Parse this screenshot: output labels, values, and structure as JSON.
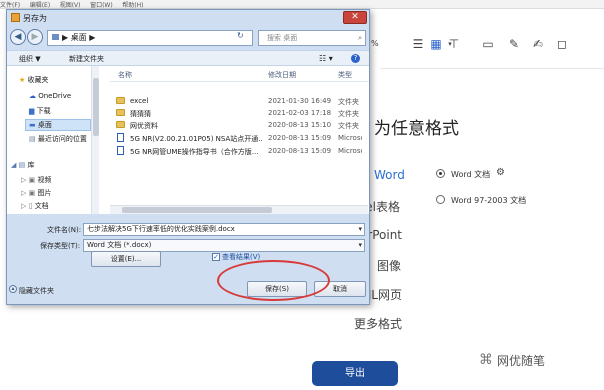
{
  "bg_app": {
    "menu": [
      "文件(F)",
      "编辑(E)",
      "视图(V)",
      "窗口(W)",
      "帮助(H)"
    ],
    "zoom": "%",
    "heading": "为任意格式",
    "formats": [
      "Word",
      "Excel表格",
      "PowerPoint",
      "图像",
      "HTML网页",
      "更多格式"
    ],
    "radio_options": [
      {
        "label": "Word 文档",
        "selected": true
      },
      {
        "label": "Word 97-2003 文档",
        "selected": false
      }
    ],
    "export_button": "导出",
    "watermark": "网优随笔"
  },
  "dialog": {
    "title": "另存为",
    "close": "✕",
    "breadcrumb": "▶ 桌面 ▶",
    "search_placeholder": "搜索 桌面",
    "toolbar": {
      "organize": "组织 ▼",
      "new_folder": "新建文件夹"
    },
    "nav_items": [
      {
        "label": "收藏夹",
        "icon": "star-icon"
      },
      {
        "label": "OneDrive",
        "icon": "cloud-icon"
      },
      {
        "label": "下载",
        "icon": "download-folder-icon"
      },
      {
        "label": "桌面",
        "icon": "desktop-icon",
        "selected": true
      },
      {
        "label": "最近访问的位置",
        "icon": "recent-icon"
      },
      {
        "label": "库",
        "icon": "library-icon"
      },
      {
        "label": "视频",
        "icon": "video-icon"
      },
      {
        "label": "图片",
        "icon": "picture-icon"
      },
      {
        "label": "文档",
        "icon": "document-icon"
      },
      {
        "label": "音乐",
        "icon": "music-icon"
      }
    ],
    "columns": [
      "名称",
      "修改日期",
      "类型"
    ],
    "files": [
      {
        "name": "excel",
        "date": "2021-01-30 16:49",
        "type": "文件夹",
        "kind": "folder"
      },
      {
        "name": "猜猜猜",
        "date": "2021-02-03 17:18",
        "type": "文件夹",
        "kind": "folder"
      },
      {
        "name": "网优资料",
        "date": "2020-08-13 15:10",
        "type": "文件夹",
        "kind": "folder"
      },
      {
        "name": "5G NR(V2.00.21.01P05) NSA站点开通...",
        "date": "2020-08-13 15:09",
        "type": "Microso",
        "kind": "doc"
      },
      {
        "name": "5G NR网管UME操作指导书（合作方版...",
        "date": "2020-08-13 15:09",
        "type": "Microso",
        "kind": "doc"
      }
    ],
    "filename_label": "文件名(N):",
    "filename_value": "七步法解决5G下行速率低的优化实践案例.docx",
    "filetype_label": "保存类型(T):",
    "filetype_value": "Word 文档 (*.docx)",
    "options_button": "设置(E)...",
    "view_result": "查看结果(V)",
    "save_button": "保存(S)",
    "cancel_button": "取消",
    "hide_folders": "隐藏文件夹"
  }
}
